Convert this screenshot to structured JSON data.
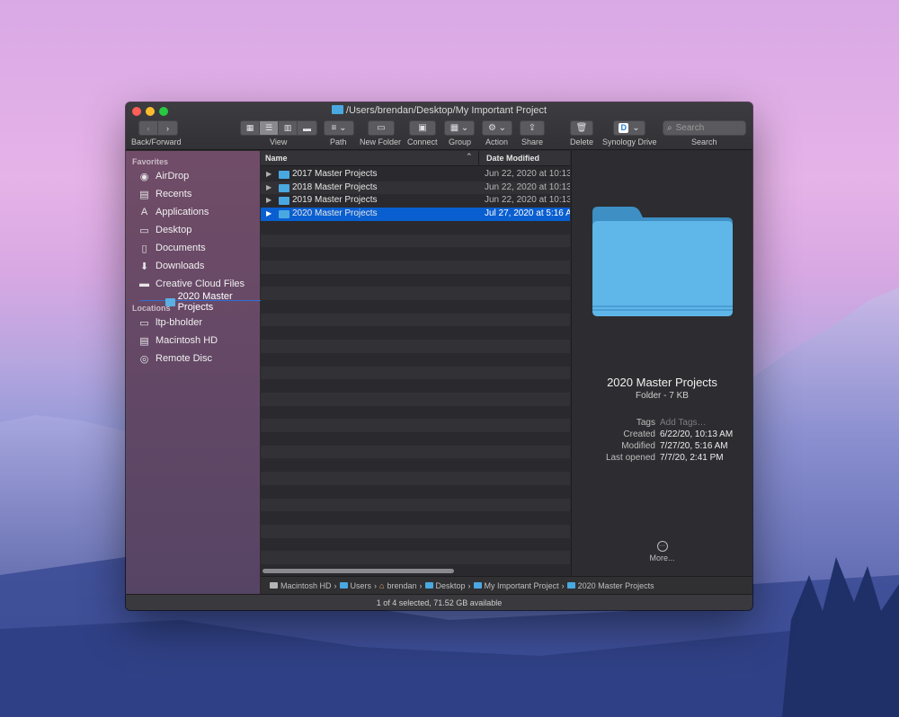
{
  "window": {
    "title": "/Users/brendan/Desktop/My Important Project"
  },
  "toolbar": {
    "back_forward_label": "Back/Forward",
    "view_label": "View",
    "path_label": "Path",
    "new_folder_label": "New Folder",
    "connect_label": "Connect",
    "group_label": "Group",
    "action_label": "Action",
    "share_label": "Share",
    "delete_label": "Delete",
    "synology_label": "Synology Drive",
    "search_label": "Search",
    "search_placeholder": "Search"
  },
  "sidebar": {
    "favorites_header": "Favorites",
    "locations_header": "Locations",
    "favorites": [
      {
        "label": "AirDrop",
        "icon": "airdrop-icon"
      },
      {
        "label": "Recents",
        "icon": "clock-icon"
      },
      {
        "label": "Applications",
        "icon": "applications-icon"
      },
      {
        "label": "Desktop",
        "icon": "desktop-icon"
      },
      {
        "label": "Documents",
        "icon": "document-icon"
      },
      {
        "label": "Downloads",
        "icon": "download-icon"
      },
      {
        "label": "Creative Cloud Files",
        "icon": "folder-icon"
      }
    ],
    "locations": [
      {
        "label": "ltp-bholder",
        "icon": "laptop-icon"
      },
      {
        "label": "Macintosh HD",
        "icon": "disk-icon"
      },
      {
        "label": "Remote Disc",
        "icon": "disc-icon"
      }
    ],
    "drag_ghost": "2020 Master Projects"
  },
  "list": {
    "col_name": "Name",
    "col_date": "Date Modified",
    "rows": [
      {
        "name": "2017 Master Projects",
        "date": "Jun 22, 2020 at 10:13",
        "selected": false
      },
      {
        "name": "2018 Master Projects",
        "date": "Jun 22, 2020 at 10:13",
        "selected": false
      },
      {
        "name": "2019 Master Projects",
        "date": "Jun 22, 2020 at 10:13",
        "selected": false
      },
      {
        "name": "2020 Master Projects",
        "date": "Jul 27, 2020 at 5:16 A",
        "selected": true
      }
    ]
  },
  "preview": {
    "name": "2020 Master Projects",
    "kind": "Folder - 7 KB",
    "tags_key": "Tags",
    "tags_value": "Add Tags…",
    "created_key": "Created",
    "created_value": "6/22/20, 10:13 AM",
    "modified_key": "Modified",
    "modified_value": "7/27/20, 5:16 AM",
    "opened_key": "Last opened",
    "opened_value": "7/7/20, 2:41 PM",
    "more_label": "More..."
  },
  "pathbar": [
    "Macintosh HD",
    "Users",
    "brendan",
    "Desktop",
    "My Important Project",
    "2020 Master Projects"
  ],
  "status": "1 of 4 selected, 71.52 GB available",
  "colors": {
    "selection": "#0a5fd0",
    "folder": "#4aa8e0"
  }
}
